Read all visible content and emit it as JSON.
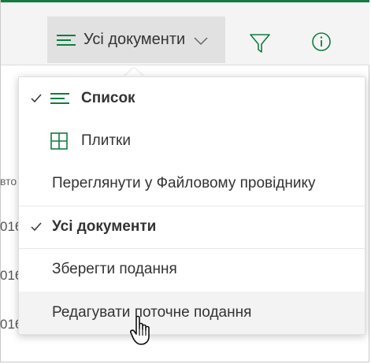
{
  "toolbar": {
    "view_label": "Усі документи",
    "filter_icon": "filter-icon",
    "info_icon": "info-icon",
    "accent_color": "#107c41"
  },
  "background": {
    "column_fragment": "вто",
    "row_fragments": [
      "016",
      "016",
      "016"
    ]
  },
  "menu": {
    "items": [
      {
        "label": "Список",
        "checked": true,
        "bold": true,
        "icon": "list-lines-icon"
      },
      {
        "label": "Плитки",
        "checked": false,
        "bold": false,
        "icon": "tiles-grid-icon"
      },
      {
        "label": "Переглянути у Файловому провіднику",
        "checked": false,
        "bold": false
      },
      {
        "label": "Усі документи",
        "checked": true,
        "bold": true
      },
      {
        "label": "Зберегти подання",
        "checked": false,
        "bold": false
      },
      {
        "label": "Редагувати поточне подання",
        "checked": false,
        "bold": false,
        "hovered": true
      }
    ]
  }
}
